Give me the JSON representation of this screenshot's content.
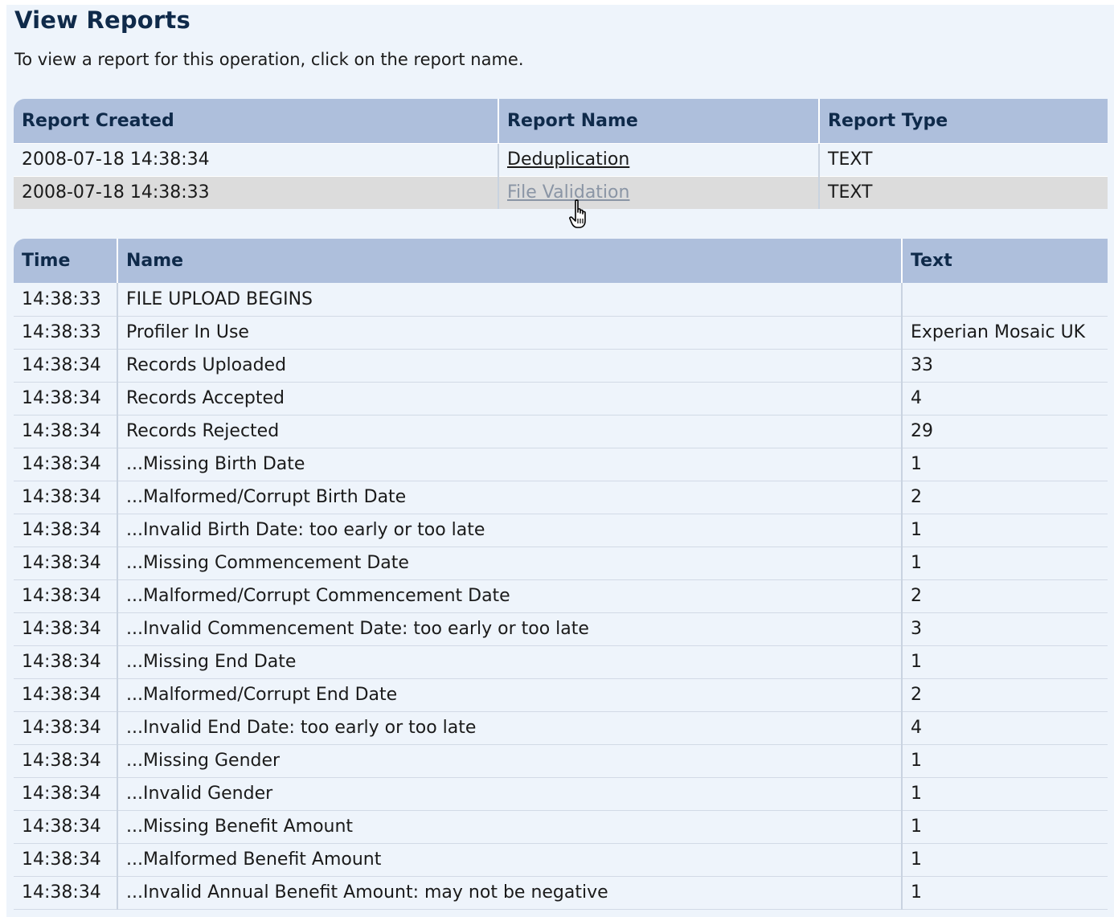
{
  "page": {
    "title": "View Reports",
    "intro": "To view a report for this operation, click on the report name."
  },
  "reports_table": {
    "headers": [
      "Report Created",
      "Report Name",
      "Report Type"
    ],
    "rows": [
      {
        "created": "2008-07-18 14:38:34",
        "name": "Deduplication",
        "type": "TEXT"
      },
      {
        "created": "2008-07-18 14:38:33",
        "name": "File Validation",
        "type": "TEXT"
      }
    ]
  },
  "log_table": {
    "headers": [
      "Time",
      "Name",
      "Text"
    ],
    "rows": [
      {
        "time": "14:38:33",
        "name": "FILE UPLOAD BEGINS",
        "text": ""
      },
      {
        "time": "14:38:33",
        "name": "Profiler In Use",
        "text": "Experian Mosaic UK"
      },
      {
        "time": "14:38:34",
        "name": "Records Uploaded",
        "text": "33"
      },
      {
        "time": "14:38:34",
        "name": "Records Accepted",
        "text": "4"
      },
      {
        "time": "14:38:34",
        "name": "Records Rejected",
        "text": "29"
      },
      {
        "time": "14:38:34",
        "name": "...Missing Birth Date",
        "text": "1"
      },
      {
        "time": "14:38:34",
        "name": "...Malformed/Corrupt Birth Date",
        "text": "2"
      },
      {
        "time": "14:38:34",
        "name": "...Invalid Birth Date: too early or too late",
        "text": "1"
      },
      {
        "time": "14:38:34",
        "name": "...Missing Commencement Date",
        "text": "1"
      },
      {
        "time": "14:38:34",
        "name": "...Malformed/Corrupt Commencement Date",
        "text": "2"
      },
      {
        "time": "14:38:34",
        "name": "...Invalid Commencement Date: too early or too late",
        "text": "3"
      },
      {
        "time": "14:38:34",
        "name": "...Missing End Date",
        "text": "1"
      },
      {
        "time": "14:38:34",
        "name": "...Malformed/Corrupt End Date",
        "text": "2"
      },
      {
        "time": "14:38:34",
        "name": "...Invalid End Date: too early or too late",
        "text": "4"
      },
      {
        "time": "14:38:34",
        "name": "...Missing Gender",
        "text": "1"
      },
      {
        "time": "14:38:34",
        "name": "...Invalid Gender",
        "text": "1"
      },
      {
        "time": "14:38:34",
        "name": "...Missing Benefit Amount",
        "text": "1"
      },
      {
        "time": "14:38:34",
        "name": "...Malformed Benefit Amount",
        "text": "1"
      },
      {
        "time": "14:38:34",
        "name": "...Invalid Annual Benefit Amount: may not be negative",
        "text": "1"
      }
    ]
  },
  "icons": {
    "cursor": "hand-pointer-icon"
  },
  "colors": {
    "header_bg": "#aebfdc",
    "panel_bg": "#eef4fb",
    "hover_row_bg": "#dcdcdc",
    "title_color": "#0f2a4a"
  }
}
